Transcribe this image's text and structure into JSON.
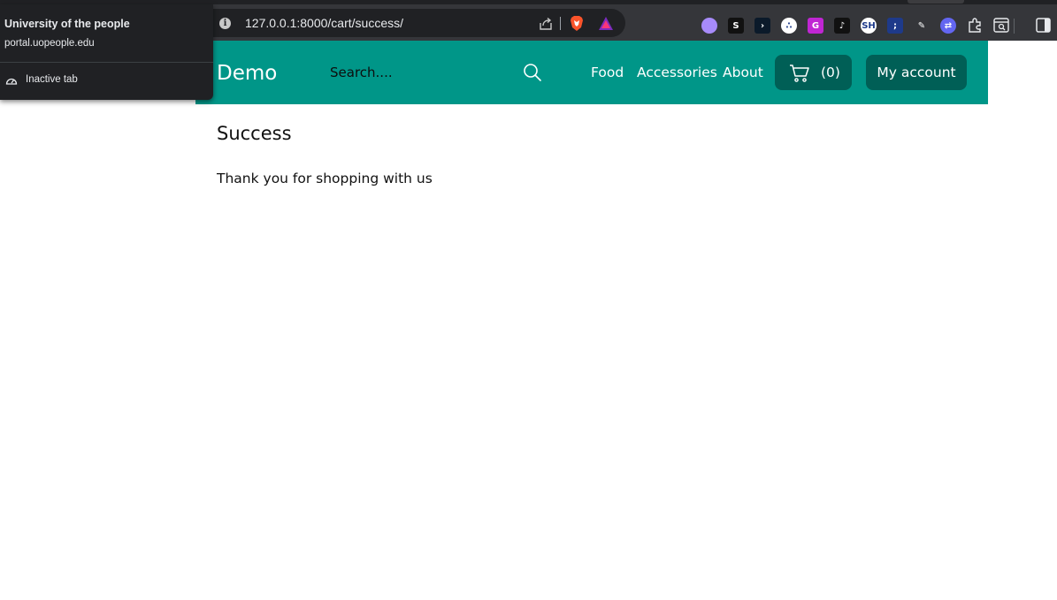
{
  "browser": {
    "url": "127.0.0.1:8000/cart/success/",
    "hover_card": {
      "title": "University of the people",
      "domain": "portal.uopeople.edu",
      "status": "Inactive tab"
    },
    "extensions": [
      {
        "name": "ghost-extension-icon",
        "glyph": "",
        "color": "#a78bfa"
      },
      {
        "name": "sync-extension-icon",
        "glyph": "S",
        "color": "#111111"
      },
      {
        "name": "play-extension-icon",
        "glyph": "›",
        "color": "#0b1a2a"
      },
      {
        "name": "dots-extension-icon",
        "glyph": "∴",
        "color": "#ffffff"
      },
      {
        "name": "g-extension-icon",
        "glyph": "G",
        "color": "#c026d3"
      },
      {
        "name": "mic-extension-icon",
        "glyph": "♪",
        "color": "#111111"
      },
      {
        "name": "sh-extension-icon",
        "glyph": "SH",
        "color": "#ffffff"
      },
      {
        "name": "semicolon-extension-icon",
        "glyph": ";",
        "color": "#1e3a8a"
      },
      {
        "name": "pen-extension-icon",
        "glyph": "✎",
        "color": "#35363a"
      },
      {
        "name": "swap-extension-icon",
        "glyph": "⇄",
        "color": "#6366f1"
      }
    ]
  },
  "navbar": {
    "brand": "Demo",
    "search_placeholder": "Search....",
    "links": [
      "Food",
      "Accessories",
      "About"
    ],
    "cart_count": "(0)",
    "account_label": "My account",
    "accent_color": "#009688",
    "button_color": "#005f56"
  },
  "content": {
    "title": "Success",
    "message": "Thank you for shopping with us"
  }
}
